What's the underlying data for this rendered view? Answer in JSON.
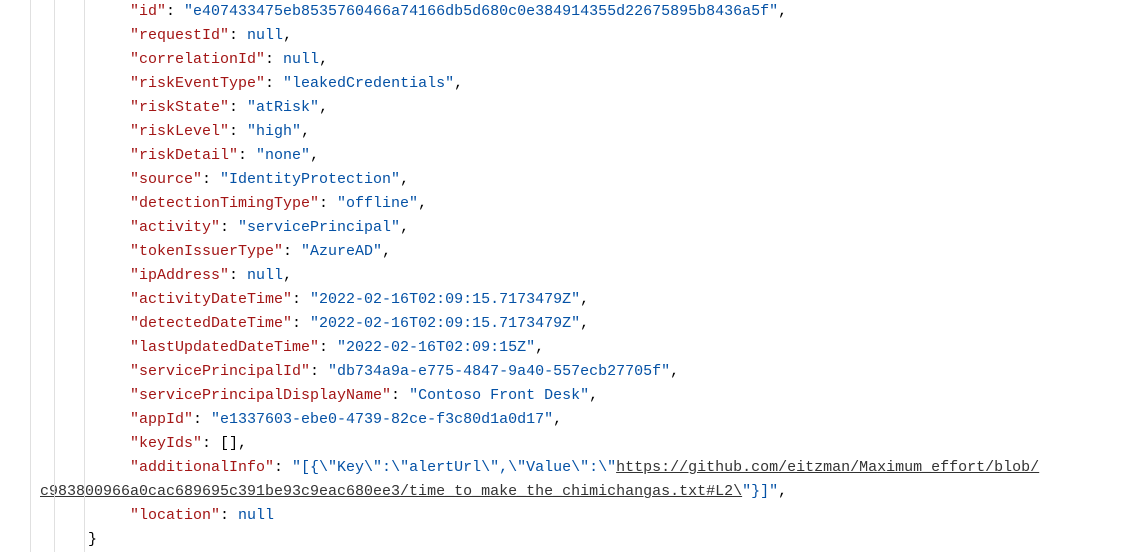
{
  "json": {
    "id_key": "\"id\"",
    "id_val": "\"e407433475eb8535760466a74166db5d680c0e384914355d22675895b8436a5f\"",
    "requestId_key": "\"requestId\"",
    "requestId_val": "null",
    "correlationId_key": "\"correlationId\"",
    "correlationId_val": "null",
    "riskEventType_key": "\"riskEventType\"",
    "riskEventType_val": "\"leakedCredentials\"",
    "riskState_key": "\"riskState\"",
    "riskState_val": "\"atRisk\"",
    "riskLevel_key": "\"riskLevel\"",
    "riskLevel_val": "\"high\"",
    "riskDetail_key": "\"riskDetail\"",
    "riskDetail_val": "\"none\"",
    "source_key": "\"source\"",
    "source_val": "\"IdentityProtection\"",
    "detectionTimingType_key": "\"detectionTimingType\"",
    "detectionTimingType_val": "\"offline\"",
    "activity_key": "\"activity\"",
    "activity_val": "\"servicePrincipal\"",
    "tokenIssuerType_key": "\"tokenIssuerType\"",
    "tokenIssuerType_val": "\"AzureAD\"",
    "ipAddress_key": "\"ipAddress\"",
    "ipAddress_val": "null",
    "activityDateTime_key": "\"activityDateTime\"",
    "activityDateTime_val": "\"2022-02-16T02:09:15.7173479Z\"",
    "detectedDateTime_key": "\"detectedDateTime\"",
    "detectedDateTime_val": "\"2022-02-16T02:09:15.7173479Z\"",
    "lastUpdatedDateTime_key": "\"lastUpdatedDateTime\"",
    "lastUpdatedDateTime_val": "\"2022-02-16T02:09:15Z\"",
    "servicePrincipalId_key": "\"servicePrincipalId\"",
    "servicePrincipalId_val": "\"db734a9a-e775-4847-9a40-557ecb27705f\"",
    "servicePrincipalDisplayName_key": "\"servicePrincipalDisplayName\"",
    "servicePrincipalDisplayName_val": "\"Contoso Front Desk\"",
    "appId_key": "\"appId\"",
    "appId_val": "\"e1337603-ebe0-4739-82ce-f3c80d1a0d17\"",
    "keyIds_key": "\"keyIds\"",
    "keyIds_val": "[]",
    "additionalInfo_key": "\"additionalInfo\"",
    "additionalInfo_prefix": "\"[{\\\"Key\\\":\\\"alertUrl\\\",\\\"Value\\\":\\\"",
    "additionalInfo_link_part1": "https://github.com/eitzman/Maximum_effort/blob/",
    "additionalInfo_link_part2": "c983800966a0cac689695c391be93c9eac680ee3/time_to_make_the_chimichangas.txt#L2\\",
    "additionalInfo_suffix": "\"}]\"",
    "location_key": "\"location\"",
    "location_val": "null"
  },
  "closing_brace": "}"
}
